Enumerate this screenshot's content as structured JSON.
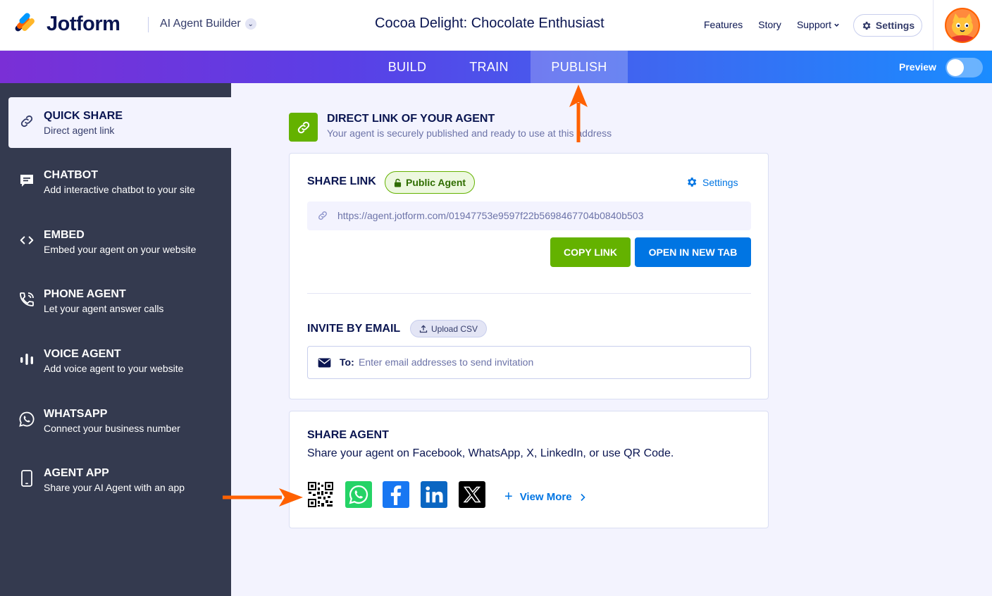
{
  "header": {
    "brand": "Jotform",
    "builder_label": "AI Agent Builder",
    "agent_title": "Cocoa Delight: Chocolate Enthusiast",
    "nav": [
      "Features",
      "Story",
      "Support"
    ],
    "settings_label": "Settings"
  },
  "tabs": {
    "items": [
      "BUILD",
      "TRAIN",
      "PUBLISH"
    ],
    "active": "PUBLISH",
    "preview_label": "Preview",
    "preview_on": false
  },
  "sidebar": {
    "items": [
      {
        "title": "QUICK SHARE",
        "subtitle": "Direct agent link",
        "icon": "link-icon",
        "active": true
      },
      {
        "title": "CHATBOT",
        "subtitle": "Add interactive chatbot to your site",
        "icon": "chat-bubble-icon"
      },
      {
        "title": "EMBED",
        "subtitle": "Embed your agent on your website",
        "icon": "code-icon"
      },
      {
        "title": "PHONE AGENT",
        "subtitle": "Let your agent answer calls",
        "icon": "phone-icon"
      },
      {
        "title": "VOICE AGENT",
        "subtitle": "Add voice agent to your website",
        "icon": "voice-bars-icon"
      },
      {
        "title": "WHATSAPP",
        "subtitle": "Connect your business number",
        "icon": "whatsapp-icon"
      },
      {
        "title": "AGENT APP",
        "subtitle": "Share your AI Agent with an app",
        "icon": "mobile-icon"
      }
    ]
  },
  "direct_link": {
    "title": "DIRECT LINK OF YOUR AGENT",
    "subtitle": "Your agent is securely published and ready to use at this address"
  },
  "share_link": {
    "title": "SHARE LINK",
    "badge": "Public Agent",
    "settings_label": "Settings",
    "url": "https://agent.jotform.com/01947753e9597f22b5698467704b0840b503",
    "copy_label": "COPY LINK",
    "open_label": "OPEN IN NEW TAB"
  },
  "invite": {
    "title": "INVITE BY EMAIL",
    "upload_label": "Upload CSV",
    "to_label": "To:",
    "placeholder": "Enter email addresses to send invitation"
  },
  "share_agent": {
    "title": "SHARE AGENT",
    "description": "Share your agent on Facebook, WhatsApp, X, LinkedIn, or use QR Code.",
    "icons": [
      "qr-code-icon",
      "whatsapp-icon",
      "facebook-icon",
      "linkedin-icon",
      "x-icon"
    ],
    "view_more_label": "View More"
  },
  "colors": {
    "accent_green": "#64b200",
    "accent_blue": "#0075e3",
    "sidebar_bg": "#343a4f",
    "annotation_arrow": "#ff6100"
  }
}
